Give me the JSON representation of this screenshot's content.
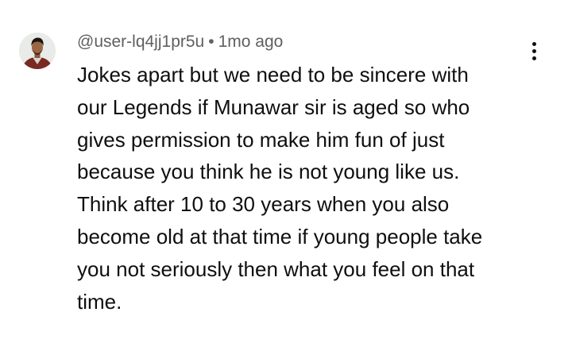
{
  "comment": {
    "author": "@user-lq4jj1pr5u",
    "separator": "•",
    "time": "1mo ago",
    "lines": [
      "Jokes apart but we need to be sincere with",
      "our Legends if Munawar sir is aged so who",
      "gives permission to make him fun of just",
      "because you think he is not young like us.",
      "Think after 10 to 30 years when you also",
      "become old at that time if young people take",
      "you not seriously then what you feel on that",
      "time."
    ],
    "more_icon": "more-vertical-icon",
    "avatar_icon": "user-avatar"
  },
  "colors": {
    "meta": "#606060",
    "text": "#0f0f0f",
    "background": "#ffffff"
  }
}
